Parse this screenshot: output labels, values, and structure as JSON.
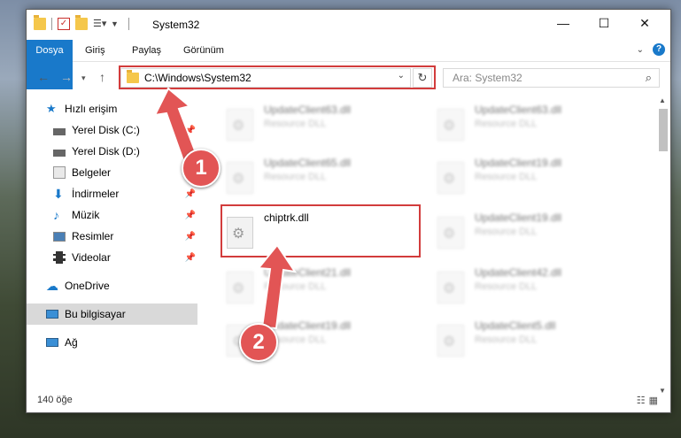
{
  "window": {
    "title": "System32"
  },
  "ribbon": {
    "tabs": [
      "Dosya",
      "Giriş",
      "Paylaş",
      "Görünüm"
    ],
    "help": "?"
  },
  "navigation": {
    "address_path": "C:\\Windows\\System32",
    "search_placeholder": "Ara: System32"
  },
  "sidebar": {
    "items": [
      {
        "label": "Hızlı erişim",
        "icon": "star-icon"
      },
      {
        "label": "Yerel Disk (C:)",
        "icon": "drive-icon"
      },
      {
        "label": "Yerel Disk (D:)",
        "icon": "drive-icon"
      },
      {
        "label": "Belgeler",
        "icon": "document-icon"
      },
      {
        "label": "İndirmeler",
        "icon": "download-icon"
      },
      {
        "label": "Müzik",
        "icon": "music-icon"
      },
      {
        "label": "Resimler",
        "icon": "picture-icon"
      },
      {
        "label": "Videolar",
        "icon": "video-icon"
      },
      {
        "label": "OneDrive",
        "icon": "cloud-icon"
      },
      {
        "label": "Bu bilgisayar",
        "icon": "computer-icon"
      },
      {
        "label": "Ağ",
        "icon": "network-icon"
      }
    ]
  },
  "files": [
    {
      "name": "UpdateClient63.dll",
      "desc": "Resource DLL"
    },
    {
      "name": "UpdateClient63.dll",
      "desc": "Resource DLL"
    },
    {
      "name": "UpdateClient65.dll",
      "desc": "Resource DLL"
    },
    {
      "name": "UpdateClient19.dll",
      "desc": "Resource DLL"
    },
    {
      "name": "chiptrk.dll",
      "desc": ""
    },
    {
      "name": "UpdateClient19.dll",
      "desc": "Resource DLL"
    },
    {
      "name": "UpdateClient21.dll",
      "desc": "Resource DLL"
    },
    {
      "name": "UpdateClient42.dll",
      "desc": "Resource DLL"
    },
    {
      "name": "UpdateClient19.dll",
      "desc": "Resource DLL"
    },
    {
      "name": "UpdateClient5.dll",
      "desc": "Resource DLL"
    }
  ],
  "status": {
    "item_count": "140 öğe"
  },
  "annotations": {
    "step1": "1",
    "step2": "2"
  },
  "colors": {
    "accent": "#1979ca",
    "highlight_red": "#d23c3c"
  }
}
